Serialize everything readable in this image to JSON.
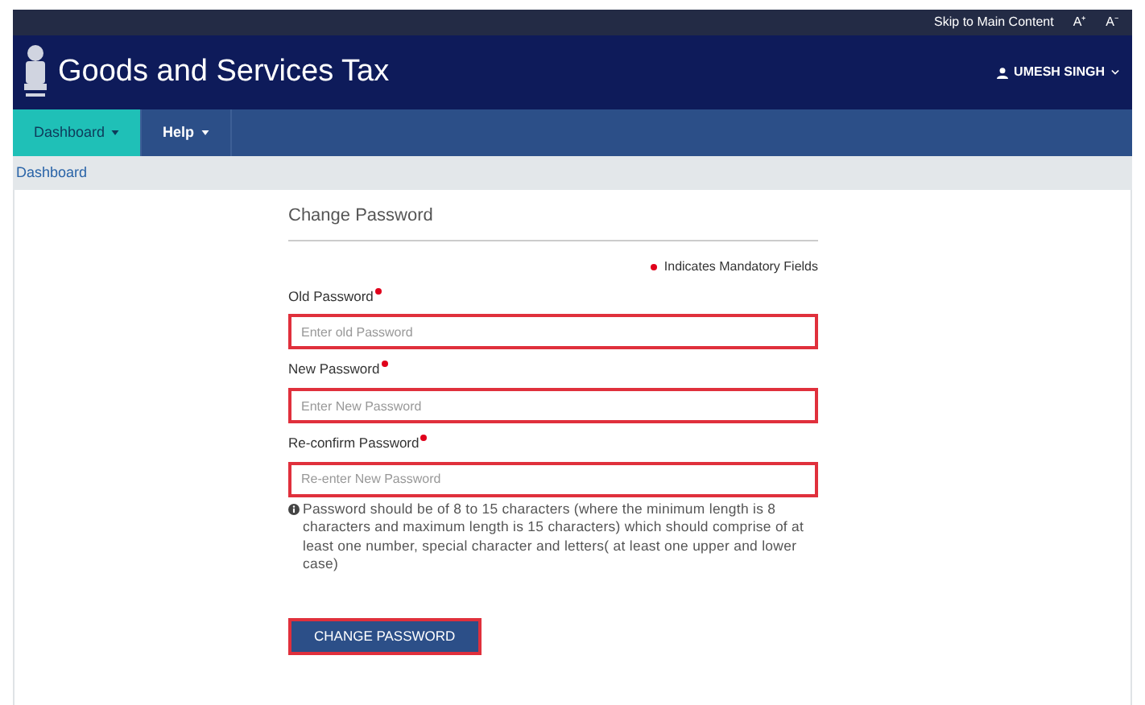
{
  "top_bar": {
    "skip_link": "Skip to Main Content",
    "font_increase": "A⁺",
    "font_decrease": "A⁻"
  },
  "header": {
    "title": "Goods and Services Tax",
    "user": "UMESH SINGH"
  },
  "nav": [
    {
      "label": "Dashboard",
      "selected": true
    },
    {
      "label": "Help",
      "selected": false
    }
  ],
  "breadcrumb": "Dashboard",
  "form": {
    "title": "Change Password",
    "mandatory_note": "Indicates Mandatory Fields",
    "fields": [
      {
        "label": "Old Password",
        "placeholder": "Enter old Password",
        "highlighted": true
      },
      {
        "label": "New Password",
        "placeholder": "Enter New Password",
        "highlighted": true
      },
      {
        "label": "Re-confirm Password",
        "placeholder": "Re-enter New Password",
        "highlighted": true
      }
    ],
    "hint": "Password should be of 8 to 15 characters (where the minimum length is 8 characters and maximum length is 15 characters) which should comprise of at least one number, special character and letters( at least one upper and lower case)",
    "button": {
      "label": "CHANGE PASSWORD",
      "highlighted": true
    }
  }
}
